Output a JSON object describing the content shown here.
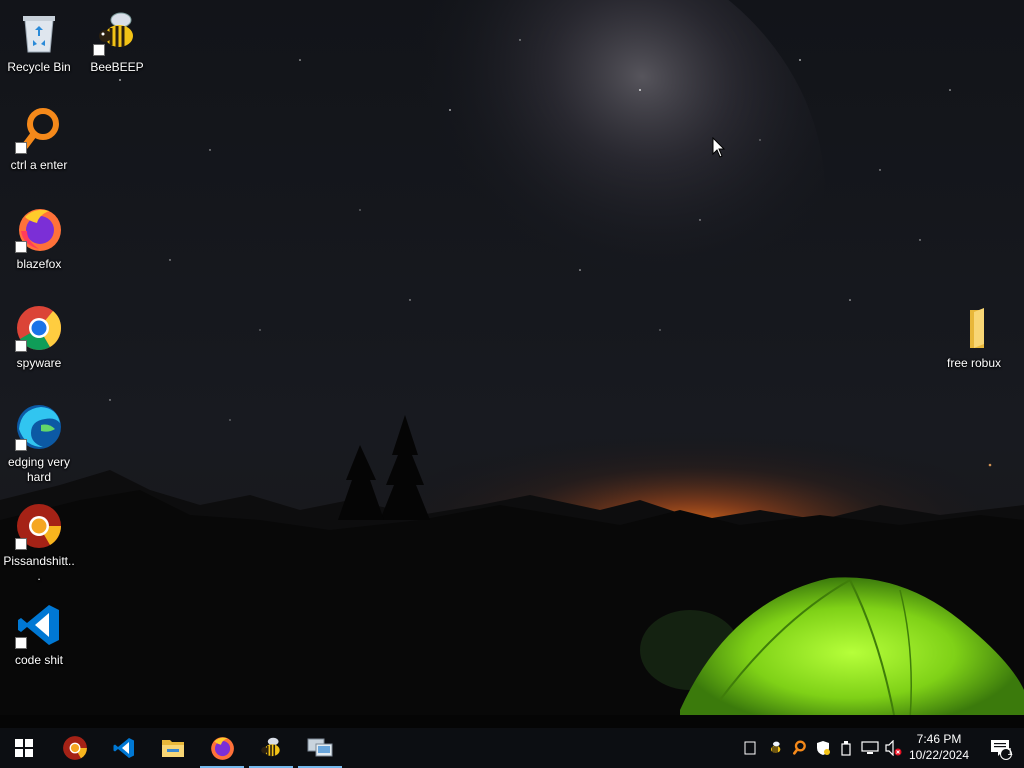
{
  "desktop": {
    "wallpaper": "night sky milky way over mountains with glowing green tent",
    "icons": [
      {
        "label": "Recycle Bin",
        "icon": "recycle-bin-icon"
      },
      {
        "label": "BeeBEEP",
        "icon": "bee-icon"
      },
      {
        "label": "ctrl a enter",
        "icon": "orange-search-icon"
      },
      {
        "label": "blazefox",
        "icon": "firefox-icon"
      },
      {
        "label": "spyware",
        "icon": "chrome-icon"
      },
      {
        "label": "edging very hard",
        "icon": "edge-icon"
      },
      {
        "label": "Pissandshitt...",
        "icon": "chrome-canary-icon"
      },
      {
        "label": "code shit",
        "icon": "vscode-icon"
      },
      {
        "label": "free robux",
        "icon": "folder-icon"
      }
    ]
  },
  "taskbar": {
    "pinned": [
      {
        "name": "start",
        "icon": "windows-start-icon"
      },
      {
        "name": "chrome-canary",
        "icon": "chrome-canary-icon"
      },
      {
        "name": "vscode",
        "icon": "vscode-icon"
      },
      {
        "name": "file-explorer",
        "icon": "folder-icon"
      },
      {
        "name": "firefox",
        "icon": "firefox-icon",
        "running": true
      },
      {
        "name": "beebeep",
        "icon": "bee-icon",
        "running": true
      },
      {
        "name": "remote",
        "icon": "remote-desktop-icon",
        "running": true
      }
    ],
    "tray": {
      "icons": [
        "show-hidden-icon",
        "bee-tray-icon",
        "search-tray-icon",
        "security-icon",
        "usb-icon",
        "network-icon",
        "volume-muted-icon"
      ]
    },
    "clock": {
      "time": "7:46 PM",
      "date": "10/22/2024"
    },
    "notifications": {
      "count": "1"
    }
  },
  "colors": {
    "taskbar": "#0c0e12",
    "running_indicator": "#76b9ed",
    "tent_green": "#8be01a",
    "horizon_glow": "#e8711a"
  }
}
